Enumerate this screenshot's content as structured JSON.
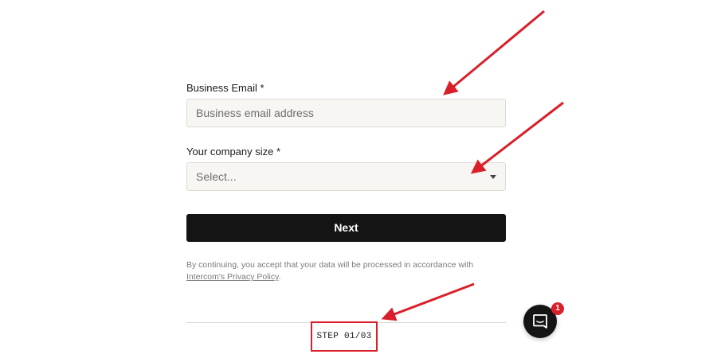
{
  "form": {
    "email": {
      "label": "Business Email *",
      "placeholder": "Business email address"
    },
    "company_size": {
      "label": "Your company size *",
      "selected": "Select..."
    },
    "next_label": "Next",
    "consent": {
      "text": "By continuing, you accept that your data will be processed in accordance with",
      "link": "Intercom's Privacy Policy",
      "suffix": "."
    }
  },
  "step": {
    "label": "STEP 01/03"
  },
  "messenger": {
    "badge_count": "1",
    "icon": "chat-bubble-icon"
  },
  "annotations": {
    "arrow_color": "#d9202a",
    "highlight_color": "#d9202a"
  },
  "colors": {
    "button_bg": "#141414",
    "input_bg": "#f7f6f2"
  }
}
